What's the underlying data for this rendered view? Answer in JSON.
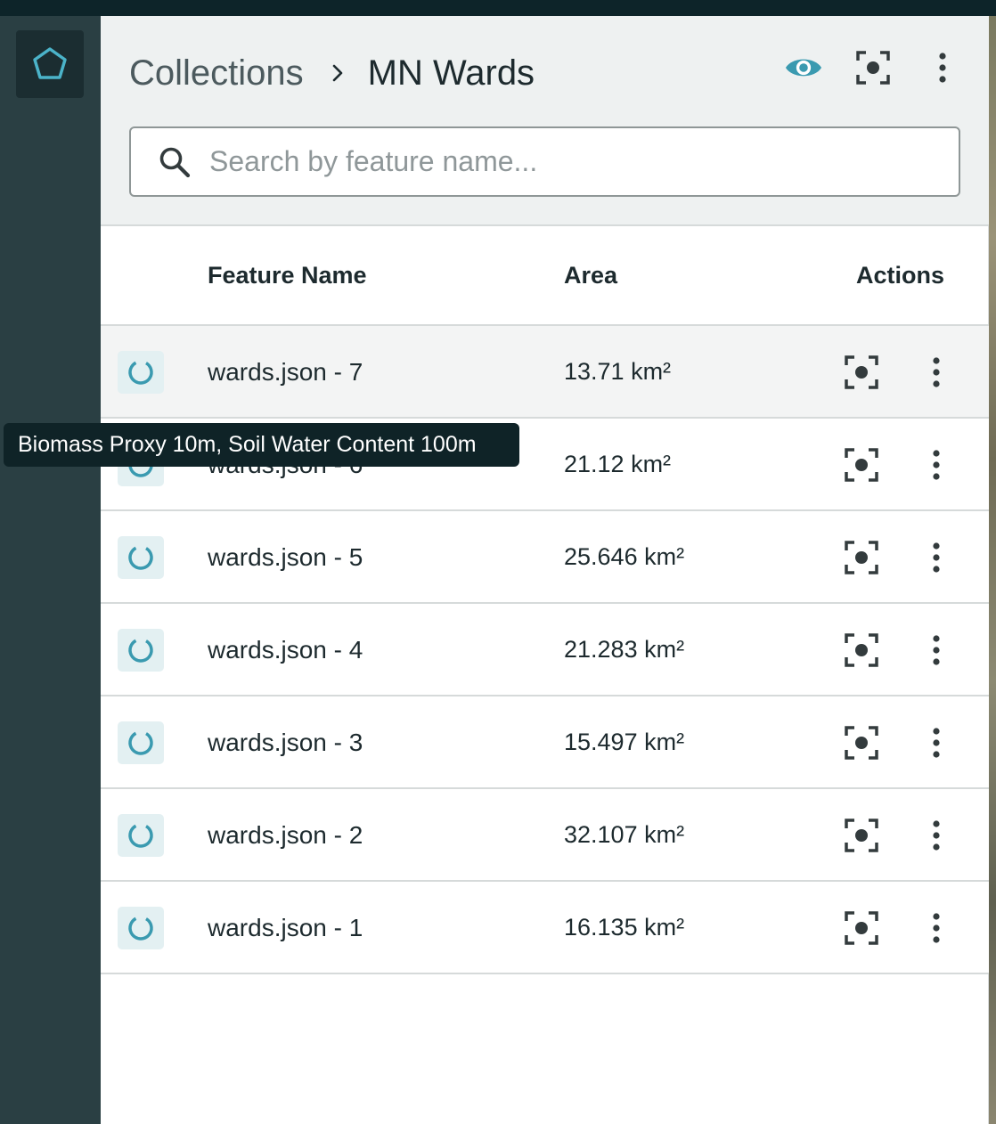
{
  "app": {
    "accent_color": "#3a9ab0",
    "rail_logo_icon": "pentagon-icon"
  },
  "header": {
    "breadcrumb_root": "Collections",
    "breadcrumb_separator_icon": "chevron-right-icon",
    "breadcrumb_current": "MN Wards",
    "actions": [
      {
        "name": "visibility-toggle",
        "icon": "eye-icon"
      },
      {
        "name": "zoom-to-collection",
        "icon": "focus-frame-icon"
      },
      {
        "name": "collection-menu",
        "icon": "kebab-menu-icon"
      }
    ]
  },
  "search": {
    "placeholder": "Search by feature name...",
    "value": ""
  },
  "table": {
    "columns": {
      "name": "Feature Name",
      "area": "Area",
      "actions": "Actions"
    },
    "rows": [
      {
        "name": "wards.json - 7",
        "area": "13.71 km²"
      },
      {
        "name": "wards.json - 6",
        "area": "21.12 km²"
      },
      {
        "name": "wards.json - 5",
        "area": "25.646 km²"
      },
      {
        "name": "wards.json - 4",
        "area": "21.283 km²"
      },
      {
        "name": "wards.json - 3",
        "area": "15.497 km²"
      },
      {
        "name": "wards.json - 2",
        "area": "32.107 km²"
      },
      {
        "name": "wards.json - 1",
        "area": "16.135 km²"
      }
    ]
  },
  "tooltip": {
    "text": "Biomass Proxy 10m, Soil Water Content 100m"
  }
}
